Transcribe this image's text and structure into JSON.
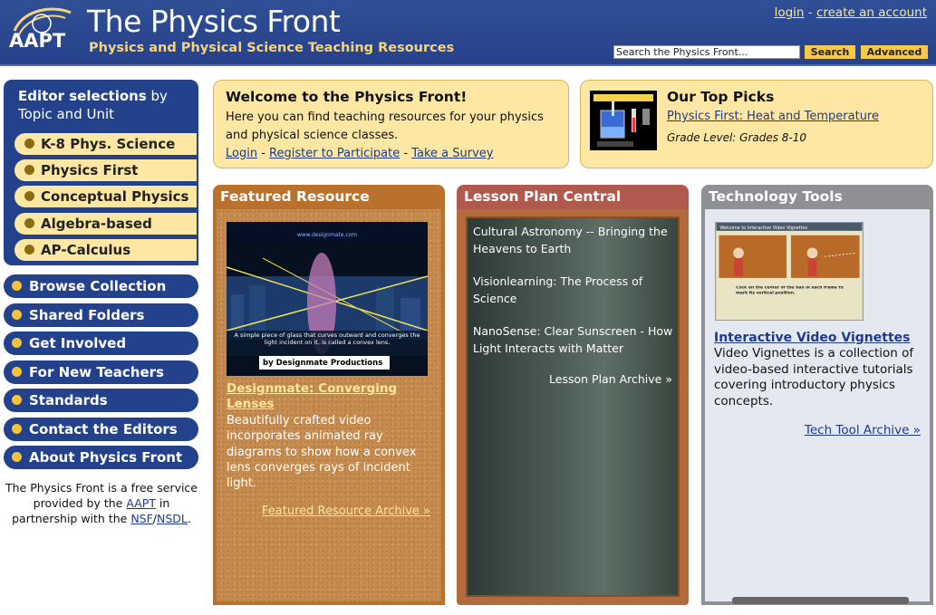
{
  "header": {
    "logo_text": "AAPT",
    "title": "The Physics Front",
    "subtitle": "Physics and Physical Science Teaching Resources",
    "login": "login",
    "separator": "-",
    "create_account": "create an account",
    "search_placeholder": "Search the Physics Front...",
    "search_button": "Search",
    "advanced_button": "Advanced"
  },
  "sidebar": {
    "editor_heading_bold": "Editor selections",
    "editor_heading_rest": " by Topic and Unit",
    "topics": [
      "K-8 Phys. Science",
      "Physics First",
      "Conceptual Physics",
      "Algebra-based",
      "AP-Calculus"
    ],
    "nav": [
      "Browse Collection",
      "Shared Folders",
      "Get Involved",
      "For New Teachers",
      "Standards",
      "Contact the Editors",
      "About Physics Front"
    ],
    "note_part1": "The Physics Front is a free service provided by the ",
    "note_aapt": "AAPT",
    "note_part2": " in partnership with the ",
    "note_nsf": "NSF",
    "note_slash": "/",
    "note_nsdl": "NSDL",
    "note_end": "."
  },
  "welcome": {
    "title": "Welcome to the Physics Front!",
    "text": "Here you can find teaching resources for your physics and physical science classes.",
    "login": "Login",
    "register": "Register to Participate",
    "survey": "Take a Survey",
    "sep": " - "
  },
  "top_picks": {
    "title": "Our Top Picks",
    "link": "Physics First: Heat and Temperature",
    "grade": "Grade Level: Grades 8-10"
  },
  "featured": {
    "heading": "Featured Resource",
    "image_url_text": "www.designmate.com",
    "image_caption": "A simple piece of glass that curves outward and converges the light incident on it, is called a convex lens.",
    "image_credit": "by Designmate Productions",
    "title": "Designmate: Converging Lenses",
    "description": "Beautifully crafted video incorporates animated ray diagrams to show how a convex lens converges rays of incident light.",
    "archive": "Featured Resource Archive »"
  },
  "lesson": {
    "heading": "Lesson Plan Central",
    "items": [
      "Cultural Astronomy -- Bringing the Heavens to Earth",
      "Visionlearning: The Process of Science",
      "NanoSense: Clear Sunscreen - How Light Interacts with Matter"
    ],
    "archive": "Lesson Plan Archive »"
  },
  "tech": {
    "heading": "Technology Tools",
    "image_header": "Welcome to Interactive Video Vignettes",
    "image_instruction": "Click on the center of the ball in each frame to mark its vertical position.",
    "title": "Interactive Video Vignettes",
    "description": "Video Vignettes is a collection of video-based interactive tutorials covering introductory physics concepts.",
    "archive": "Tech Tool Archive »"
  },
  "colors": {
    "header_blue": "#26418a",
    "accent_yellow": "#f7c94a",
    "pill_yellow": "#fde7a3",
    "featured": "#b9712c",
    "lesson": "#b05a4f",
    "tech": "#8f8f96"
  }
}
